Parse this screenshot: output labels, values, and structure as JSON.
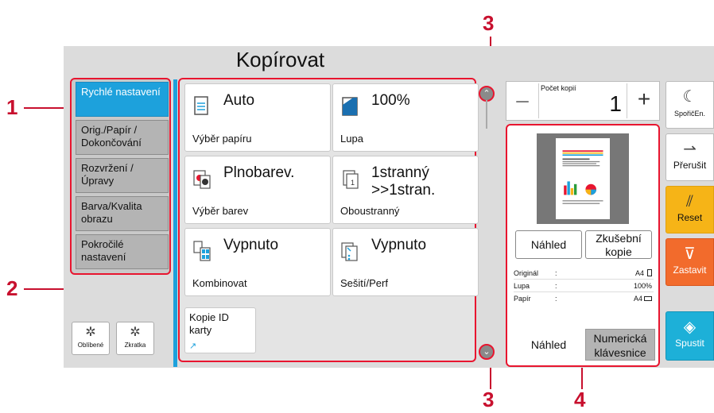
{
  "callouts": {
    "c1": "1",
    "c2": "2",
    "c3_top": "3",
    "c3_bottom": "3",
    "c4": "4"
  },
  "header": {
    "title": "Kopírovat"
  },
  "left_menu": [
    {
      "label": "Rychlé nastavení",
      "active": true
    },
    {
      "label": "Orig./Papír / Dokončování",
      "active": false
    },
    {
      "label": "Rozvržení /Úpravy",
      "active": false
    },
    {
      "label": "Barva/Kvalita obrazu",
      "active": false
    },
    {
      "label": "Pokročilé nastavení",
      "active": false
    }
  ],
  "bottom_buttons": {
    "favorites": "Oblíbené",
    "shortcut": "Zkratka"
  },
  "functions": {
    "paper": {
      "value": "Auto",
      "label": "Výběr papíru"
    },
    "zoom": {
      "value": "100%",
      "label": "Lupa"
    },
    "color": {
      "value": "Plnobarev.",
      "label": "Výběr barev"
    },
    "duplex": {
      "value": "1stranný >>1stran.",
      "label": "Oboustranný"
    },
    "combine": {
      "value": "Vypnuto",
      "label": "Kombinovat"
    },
    "staple": {
      "value": "Vypnuto",
      "label": "Sešití/Perf"
    },
    "idcard": {
      "label": "Kopie ID karty"
    }
  },
  "copies": {
    "label": "Počet kopií",
    "value": "1",
    "minus": "–",
    "plus": "+"
  },
  "preview": {
    "btn_preview": "Náhled",
    "btn_proof": "Zkušební kopie",
    "rows": [
      {
        "key": "Originál",
        "sep": ":",
        "val": "A4"
      },
      {
        "key": "Lupa",
        "sep": ":",
        "val": "100%"
      },
      {
        "key": "Papír",
        "sep": ":",
        "val": "A4"
      }
    ],
    "tab_preview": "Náhled",
    "tab_numeric": "Numerická klávesnice"
  },
  "side_buttons": {
    "sleep": "SpořičEn.",
    "interrupt": "Přerušit",
    "reset": "Reset",
    "stop": "Zastavit",
    "start": "Spustit"
  },
  "colors": {
    "accent": "#1da1dc",
    "callout": "#c8102e",
    "reset": "#f6b417",
    "stop": "#f26b2c",
    "start": "#1db0d8"
  }
}
